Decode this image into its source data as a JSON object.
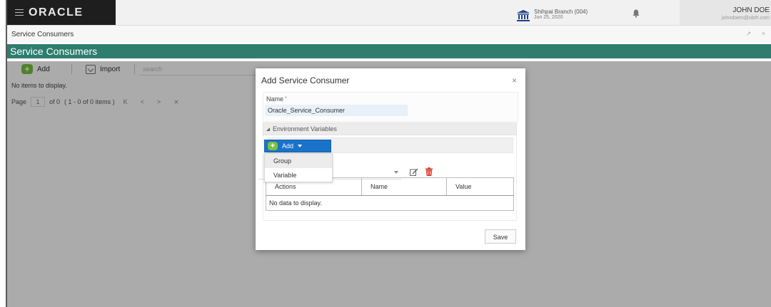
{
  "topbar": {
    "logo": "ORACLE",
    "branch_name": "Shihpai Branch (004)",
    "branch_date": "Jun 25, 2020",
    "user_name": "JOHN DOE",
    "user_email": "johndoem@obrh.com"
  },
  "breadcrumb": {
    "title": "Service Consumers",
    "controls": "↗ ×"
  },
  "page": {
    "title": "Service Consumers",
    "toolbar": {
      "add_label": "Add",
      "import_label": "Import",
      "search_placeholder": "search"
    },
    "empty_text": "No items to display.",
    "pager": {
      "page_label": "Page",
      "page_value": "1",
      "of_label": "of 0",
      "range_text": "( 1 - 0 of 0 items )",
      "first": "K",
      "prev": "<",
      "next": ">",
      "last": "⨯"
    }
  },
  "modal": {
    "title": "Add Service Consumer",
    "close": "×",
    "name_label": "Name",
    "name_required": "*",
    "name_value": "Oracle_Service_Consumer",
    "env_section_label": "Environment Variables",
    "add_button_label": "Add",
    "dropdown_items": [
      "Group",
      "Variable"
    ],
    "table": {
      "headers": [
        "Actions",
        "Name",
        "Value"
      ],
      "empty_text": "No data to display."
    },
    "save_label": "Save"
  },
  "colors": {
    "title_bar": "#2e7d6f",
    "add_button": "#1a73c8",
    "plus_icon": "#7ac142",
    "trash_icon": "#d9372a"
  }
}
